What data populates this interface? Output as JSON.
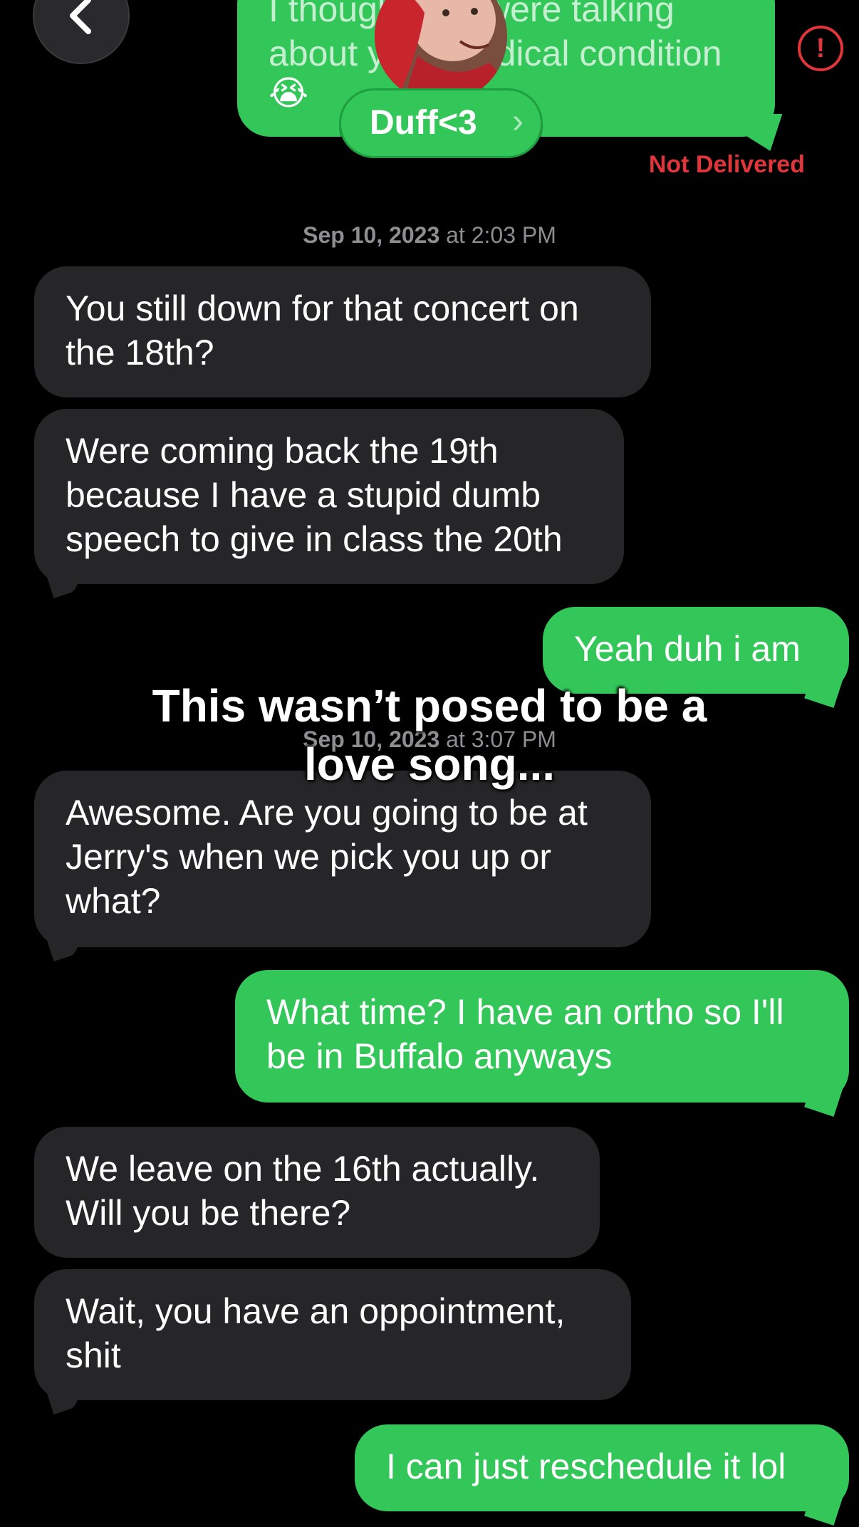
{
  "header": {
    "contact_name": "Duff<3",
    "chevron": "›",
    "back_icon": "chevron-left-icon",
    "error_icon": "exclamation-circle-icon"
  },
  "top_message": {
    "text": "I thought you were talking\nabout your medical condition",
    "emoji": "😭",
    "status": "Not Delivered"
  },
  "messages": [
    {
      "type": "timestamp",
      "date": "Sep 10, 2023",
      "time": "at 2:03 PM"
    },
    {
      "type": "incoming",
      "text": "You still down for that concert on\nthe 18th?"
    },
    {
      "type": "incoming",
      "text": "Were coming back the 19th\nbecause I have a stupid dumb\nspeech to give in class the 20th"
    },
    {
      "type": "outgoing",
      "text": "Yeah duh i am"
    },
    {
      "type": "timestamp",
      "date": "Sep 10, 2023",
      "time": "at 3:07 PM"
    },
    {
      "type": "incoming",
      "text": "Awesome. Are you going to be at\nJerry's when we pick you up or\nwhat?"
    },
    {
      "type": "outgoing",
      "text": "What time? I have an ortho so I'll\nbe in Buffalo anyways"
    },
    {
      "type": "incoming",
      "text": "We leave on the 16th actually.\nWill you be there?"
    },
    {
      "type": "incoming",
      "text": "Wait, you have an oppointment,\nshit"
    },
    {
      "type": "outgoing",
      "text": "I can just reschedule it lol"
    }
  ],
  "overlay": {
    "caption": "This wasn’t posed to be a\nlove song..."
  },
  "colors": {
    "outgoing": "#33c759",
    "incoming": "#262628",
    "error": "#e0353a",
    "timestamp": "#8d8d92"
  }
}
